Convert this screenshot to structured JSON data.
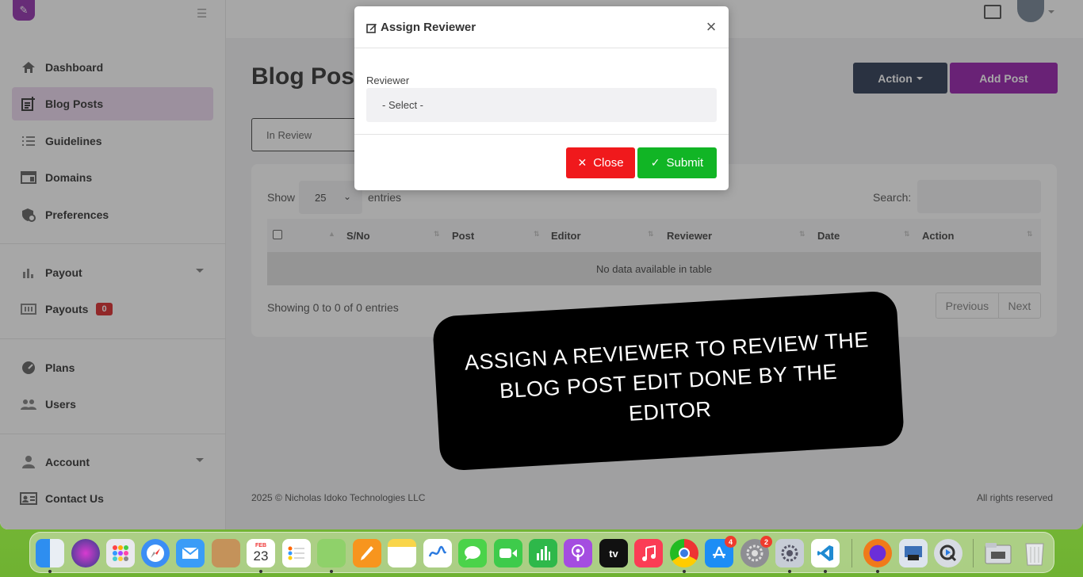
{
  "sidebar": {
    "items": [
      {
        "label": "Dashboard",
        "icon": "home-icon"
      },
      {
        "label": "Blog Posts",
        "icon": "post-add-icon"
      },
      {
        "label": "Guidelines",
        "icon": "list-icon"
      },
      {
        "label": "Domains",
        "icon": "web-icon"
      },
      {
        "label": "Preferences",
        "icon": "shield-gear-icon"
      },
      {
        "label": "Payout",
        "icon": "bar-chart-icon"
      },
      {
        "label": "Payouts",
        "icon": "money-icon",
        "badge": "0"
      },
      {
        "label": "Plans",
        "icon": "speed-icon"
      },
      {
        "label": "Users",
        "icon": "people-icon"
      },
      {
        "label": "Account",
        "icon": "person-icon"
      },
      {
        "label": "Contact Us",
        "icon": "contact-card-icon"
      }
    ]
  },
  "main": {
    "title": "Blog Post",
    "action_label": "Action",
    "add_label": "Add Post",
    "status_filter": "In Review",
    "show_label": "Show",
    "page_length": "25",
    "entries_label": "entries",
    "search_label": "Search:",
    "columns": [
      "S/No",
      "Post",
      "Editor",
      "Reviewer",
      "Date",
      "Action"
    ],
    "empty_text": "No data available in table",
    "info_text": "Showing 0 to 0 of 0 entries",
    "prev_label": "Previous",
    "next_label": "Next"
  },
  "footer": {
    "left": "2025 © Nicholas Idoko Technologies LLC",
    "right": "All rights reserved"
  },
  "modal": {
    "title": "Assign Reviewer",
    "reviewer_label": "Reviewer",
    "reviewer_value": "- Select -",
    "close_label": "Close",
    "submit_label": "Submit"
  },
  "banner": {
    "text": "ASSIGN A REVIEWER TO REVIEW THE BLOG POST EDIT DONE BY THE EDITOR"
  },
  "dock": {
    "calendar_month": "FEB",
    "calendar_day": "23",
    "appstore_badge": "4",
    "settings_badge": "2",
    "tv_label": "tv"
  },
  "colors": {
    "brand": "#8e0ea6",
    "action_button": "#1c2a45",
    "close_button": "#f0191c",
    "submit_button": "#11b525",
    "active_nav": "#ecd6ef"
  }
}
